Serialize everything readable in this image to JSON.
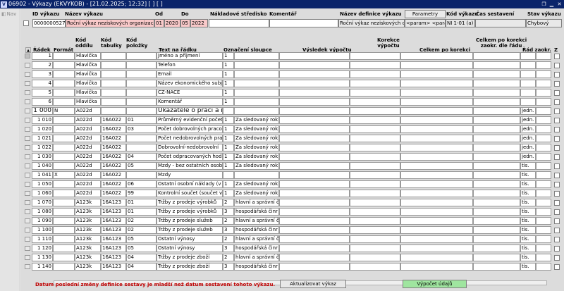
{
  "window": {
    "title": "06902 - Výkazy (EKVYKOB) - [21.02.2025; 12:32]  [  ]  [  ]",
    "app_icon": "app-icon",
    "buttons": [
      "minimize",
      "restore",
      "close"
    ]
  },
  "nav": {
    "label": "Nav"
  },
  "header": {
    "labels": {
      "id": "ID výkazu",
      "name": "Název výkazu",
      "od": "Od",
      "do": "Do",
      "cost_center": "Nákladové středisko",
      "comment": "Komentář",
      "def_name": "Název definice výkazu",
      "params_btn": "Parametry",
      "code": "Kód výkazu",
      "time": "Čas sestavení",
      "state": "Stav výkazu"
    },
    "values": {
      "id": "0000000527",
      "name": "Roční výkaz neziskových organizací, b",
      "od_m": "01",
      "od_y": "2020",
      "do_m": "05",
      "do_y": "2022",
      "cost_center": "",
      "comment": "",
      "def_name": "Roční výkaz neziskových or",
      "params": "<param>  <para",
      "code": "NI 1-01 (a)",
      "time": "",
      "state": "Chybový"
    }
  },
  "columns": {
    "radek": "Řádek",
    "format": "Formát",
    "kod_oddilu": "Kód\noddílu",
    "kod_tabulky": "Kód\ntabulky",
    "kod_polozky": "Kód\npoložky",
    "text": "Text na řádku",
    "oznaceni": "Označení sloupce",
    "vysledek": "Výsledek výpočtu",
    "korekce": "Korekce\nvýpočtu",
    "celkem": "Celkem po korekci",
    "celkem_zaokr": "Celkem po korekci\nzaokr. dle řádu",
    "rad_zaokr": "Řád zaokr.",
    "z": "Z"
  },
  "rows": [
    {
      "radek": "1",
      "format": "",
      "oddil": "Hlavička",
      "tabulka": "",
      "polozka": "",
      "text": "Jméno a příjmení",
      "ozn": "1",
      "ozn2": "",
      "rad": "",
      "big": false
    },
    {
      "radek": "2",
      "format": "",
      "oddil": "Hlavička",
      "tabulka": "",
      "polozka": "",
      "text": "Telefon",
      "ozn": "1",
      "ozn2": "",
      "rad": "",
      "big": false
    },
    {
      "radek": "3",
      "format": "",
      "oddil": "Hlavička",
      "tabulka": "",
      "polozka": "",
      "text": "Email",
      "ozn": "1",
      "ozn2": "",
      "rad": "",
      "big": false
    },
    {
      "radek": "4",
      "format": "",
      "oddil": "Hlavička",
      "tabulka": "",
      "polozka": "",
      "text": "Název ekonomického subje",
      "ozn": "1",
      "ozn2": "",
      "rad": "",
      "big": false
    },
    {
      "radek": "5",
      "format": "",
      "oddil": "Hlavička",
      "tabulka": "",
      "polozka": "",
      "text": "CZ-NACE",
      "ozn": "1",
      "ozn2": "",
      "rad": "",
      "big": false
    },
    {
      "radek": "6",
      "format": "",
      "oddil": "Hlavička",
      "tabulka": "",
      "polozka": "",
      "text": "Komentář",
      "ozn": "1",
      "ozn2": "",
      "rad": "",
      "big": false
    },
    {
      "radek": "1 000",
      "format": "N",
      "oddil": "A022d",
      "tabulka": "",
      "polozka": "",
      "text": "Ukazatele o práci a mzo",
      "ozn": "",
      "ozn2": "",
      "rad": "jedn.",
      "big": true
    },
    {
      "radek": "1 010",
      "format": "",
      "oddil": "A022d",
      "tabulka": "16A022",
      "polozka": "01",
      "text": "Průměrný evidenční počet za",
      "ozn": "1",
      "ozn2": "Za sledovaný rok",
      "rad": "jedn.",
      "big": false
    },
    {
      "radek": "1 020",
      "format": "",
      "oddil": "A022d",
      "tabulka": "16A022",
      "polozka": "03",
      "text": "Počet dobrovolných pracovn",
      "ozn": "1",
      "ozn2": "Za sledovaný rok",
      "rad": "jedn.",
      "big": false
    },
    {
      "radek": "1 021",
      "format": "",
      "oddil": "A022d",
      "tabulka": "16A022",
      "polozka": "",
      "text": "Počet nedobrovolných pracc",
      "ozn": "1",
      "ozn2": "Za sledovaný rok",
      "rad": "jedn.",
      "big": false
    },
    {
      "radek": "1 022",
      "format": "",
      "oddil": "A022d",
      "tabulka": "16A022",
      "polozka": "",
      "text": "Dobrovolní-nedobrovolní",
      "ozn": "1",
      "ozn2": "Za sledovaný rok",
      "rad": "jedn.",
      "big": false
    },
    {
      "radek": "1 030",
      "format": "",
      "oddil": "A022d",
      "tabulka": "16A022",
      "polozka": "04",
      "text": "Počet odpracovaných hodin",
      "ozn": "1",
      "ozn2": "Za sledovaný rok",
      "rad": "jedn.",
      "big": false
    },
    {
      "radek": "1 040",
      "format": "",
      "oddil": "A022d",
      "tabulka": "16A022",
      "polozka": "05",
      "text": "Mzdy - bez ostatních osobní",
      "ozn": "1",
      "ozn2": "Za sledovaný rok",
      "rad": "tis.",
      "big": false
    },
    {
      "radek": "1 041",
      "format": "X",
      "oddil": "A022d",
      "tabulka": "16A022",
      "polozka": "",
      "text": "Mzdy",
      "ozn": "",
      "ozn2": "",
      "rad": "tis.",
      "big": false
    },
    {
      "radek": "1 050",
      "format": "",
      "oddil": "A022d",
      "tabulka": "16A022",
      "polozka": "06",
      "text": "Ostatní osobní náklady (v tis",
      "ozn": "1",
      "ozn2": "Za sledovaný rok",
      "rad": "tis.",
      "big": false
    },
    {
      "radek": "1 060",
      "format": "",
      "oddil": "A022d",
      "tabulka": "16A022",
      "polozka": "99",
      "text": "Kontrolní součet (součet vše",
      "ozn": "1",
      "ozn2": "Za sledovaný rok",
      "rad": "tis.",
      "big": false
    },
    {
      "radek": "1 070",
      "format": "",
      "oddil": "A123k",
      "tabulka": "16A123",
      "polozka": "01",
      "text": "Tržby z prodeje výrobků",
      "ozn": "2",
      "ozn2": "hlavní a správní či",
      "rad": "tis.",
      "big": false
    },
    {
      "radek": "1 080",
      "format": "",
      "oddil": "A123k",
      "tabulka": "16A123",
      "polozka": "01",
      "text": "Tržby z prodeje výrobků",
      "ozn": "3",
      "ozn2": "hospodářská činr",
      "rad": "tis.",
      "big": false
    },
    {
      "radek": "1 090",
      "format": "",
      "oddil": "A123k",
      "tabulka": "16A123",
      "polozka": "02",
      "text": "Tržby z prodeje služeb",
      "ozn": "2",
      "ozn2": "hlavní a správní či",
      "rad": "tis.",
      "big": false
    },
    {
      "radek": "1 100",
      "format": "",
      "oddil": "A123k",
      "tabulka": "16A123",
      "polozka": "02",
      "text": "Tržby z prodeje služeb",
      "ozn": "3",
      "ozn2": "hospodářská činr",
      "rad": "tis.",
      "big": false
    },
    {
      "radek": "1 110",
      "format": "",
      "oddil": "A123k",
      "tabulka": "16A123",
      "polozka": "05",
      "text": "Ostatní výnosy",
      "ozn": "2",
      "ozn2": "hlavní a správní či",
      "rad": "tis.",
      "big": false
    },
    {
      "radek": "1 120",
      "format": "",
      "oddil": "A123k",
      "tabulka": "16A123",
      "polozka": "05",
      "text": "Ostatní výnosy",
      "ozn": "3",
      "ozn2": "hospodářská činr",
      "rad": "tis.",
      "big": false
    },
    {
      "radek": "1 130",
      "format": "",
      "oddil": "A123k",
      "tabulka": "16A123",
      "polozka": "04",
      "text": "Tržby z prodeje zboží",
      "ozn": "2",
      "ozn2": "hlavní a správní či",
      "rad": "tis.",
      "big": false
    },
    {
      "radek": "1 140",
      "format": "",
      "oddil": "A123k",
      "tabulka": "16A123",
      "polozka": "04",
      "text": "Tržby z prodeje zboží",
      "ozn": "3",
      "ozn2": "hospodářská činr",
      "rad": "tis.",
      "big": false
    }
  ],
  "footer": {
    "warning": "Datum poslední změny definice sestavy je mladší než datum sestavení tohoto výkazu.",
    "update_btn": "Aktualizovat výkaz",
    "calc_btn": "Výpočet údajů"
  },
  "colors": {
    "title_bg": "#0a246a",
    "required_field": "#f9c9c9",
    "warning_text": "#c00000",
    "calc_button": "#9fe59f"
  }
}
